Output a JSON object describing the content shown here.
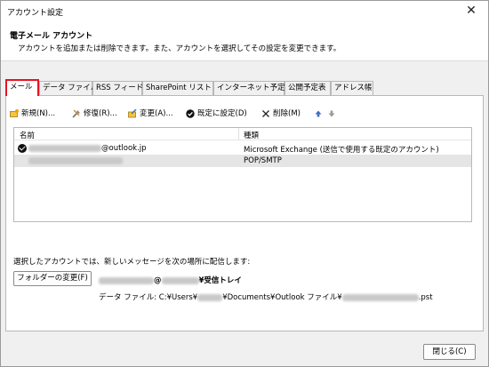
{
  "window": {
    "title": "アカウント設定",
    "close_glyph": "✕"
  },
  "header": {
    "title": "電子メール アカウント",
    "description": "アカウントを追加または削除できます。また、アカウントを選択してその設定を変更できます。"
  },
  "tabs": [
    {
      "label": "メール",
      "active": true
    },
    {
      "label": "データ ファイル"
    },
    {
      "label": "RSS フィード"
    },
    {
      "label": "SharePoint リスト"
    },
    {
      "label": "インターネット予定表"
    },
    {
      "label": "公開予定表"
    },
    {
      "label": "アドレス帳"
    }
  ],
  "toolbar": {
    "new": "新規(N)...",
    "repair": "修復(R)...",
    "change": "変更(A)...",
    "set_default": "既定に設定(D)",
    "delete": "削除(M)",
    "up_icon": "up-arrow-icon",
    "down_icon": "down-arrow-icon"
  },
  "accounts": {
    "col_name": "名前",
    "col_type": "種類",
    "rows": [
      {
        "name_suffix": "@outlook.jp",
        "type": "Microsoft Exchange (送信で使用する既定のアカウント)",
        "default": true
      },
      {
        "name_suffix": "",
        "type": "POP/SMTP",
        "default": false
      }
    ]
  },
  "delivery": {
    "label": "選択したアカウントでは、新しいメッセージを次の場所に配信します:",
    "folder_button": "フォルダーの変更(F)",
    "inbox_middle": "@",
    "inbox_suffix": "¥受信トレイ",
    "datafile_prefix": "データ ファイル: C:¥Users¥",
    "datafile_middle": "¥Documents¥Outlook ファイル¥",
    "datafile_suffix": ".pst"
  },
  "footer": {
    "close_button": "閉じる(C)"
  },
  "colors": {
    "active_tab_border": "#e81123",
    "selected_row": "#e5e5e5"
  }
}
